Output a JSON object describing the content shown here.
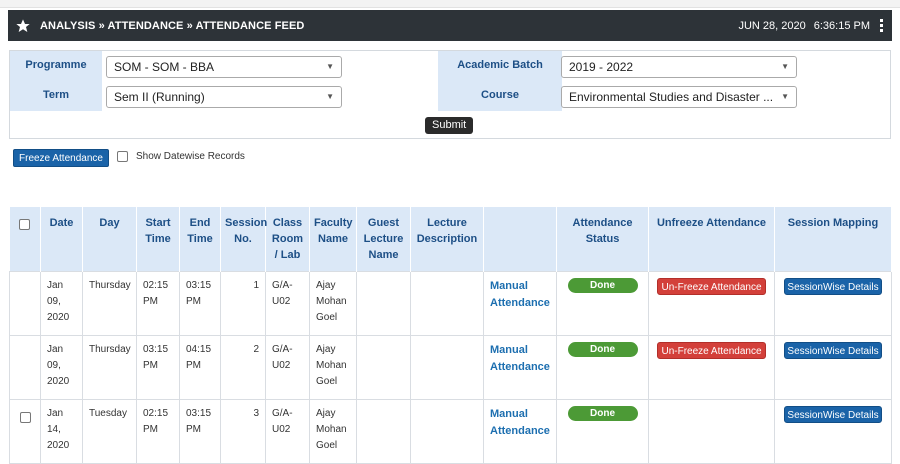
{
  "header": {
    "breadcrumb": "ANALYSIS » ATTENDANCE » ATTENDANCE FEED",
    "date": "JUN 28, 2020",
    "time": "6:36:15 PM"
  },
  "filters": {
    "programme_label": "Programme",
    "programme_value": "SOM - SOM - BBA",
    "academic_batch_label": "Academic Batch",
    "academic_batch_value": "2019 - 2022",
    "term_label": "Term",
    "term_value": "Sem II (Running)",
    "course_label": "Course",
    "course_value": "Environmental Studies and Disaster ...",
    "submit_label": "Submit"
  },
  "actions": {
    "freeze_label": "Freeze Attendance",
    "show_datewise_label": "Show Datewise Records"
  },
  "table": {
    "headers": {
      "date": "Date",
      "day": "Day",
      "start_time": "Start Time",
      "end_time": "End Time",
      "session_no": "Session No.",
      "class_room": "Class Room / Lab",
      "faculty": "Faculty Name",
      "guest": "Guest Lecture Name",
      "lecture_desc": "Lecture Description",
      "att_status": "Attendance Status",
      "unfreeze": "Unfreeze Attendance",
      "mapping": "Session Mapping"
    },
    "rows": [
      {
        "date": "Jan 09, 2020",
        "day": "Thursday",
        "start": "02:15 PM",
        "end": "03:15 PM",
        "session": "1",
        "room": "G/A-U02",
        "faculty": "Ajay Mohan Goel",
        "manual": "Manual Attendance",
        "status": "Done",
        "unfreeze": "Un-Freeze Attendance",
        "mapping": "SessionWise Details"
      },
      {
        "date": "Jan 09, 2020",
        "day": "Thursday",
        "start": "03:15 PM",
        "end": "04:15 PM",
        "session": "2",
        "room": "G/A-U02",
        "faculty": "Ajay Mohan Goel",
        "manual": "Manual Attendance",
        "status": "Done",
        "unfreeze": "Un-Freeze Attendance",
        "mapping": "SessionWise Details"
      },
      {
        "date": "Jan 14, 2020",
        "day": "Tuesday",
        "start": "02:15 PM",
        "end": "03:15 PM",
        "session": "3",
        "room": "G/A-U02",
        "faculty": "Ajay Mohan Goel",
        "manual": "Manual Attendance",
        "status": "Done",
        "unfreeze": "",
        "mapping": "SessionWise Details"
      }
    ]
  },
  "colors": {
    "header_bg": "#2d3338",
    "label_bg": "#dbe8f7",
    "label_text": "#1d4f86",
    "primary_button": "#1a63a8",
    "done_green": "#4c9a36",
    "unfreeze_red": "#d3403a"
  },
  "icons": [
    "star-icon",
    "kebab-menu-icon",
    "dropdown-arrow-icon",
    "checkbox-icon"
  ]
}
